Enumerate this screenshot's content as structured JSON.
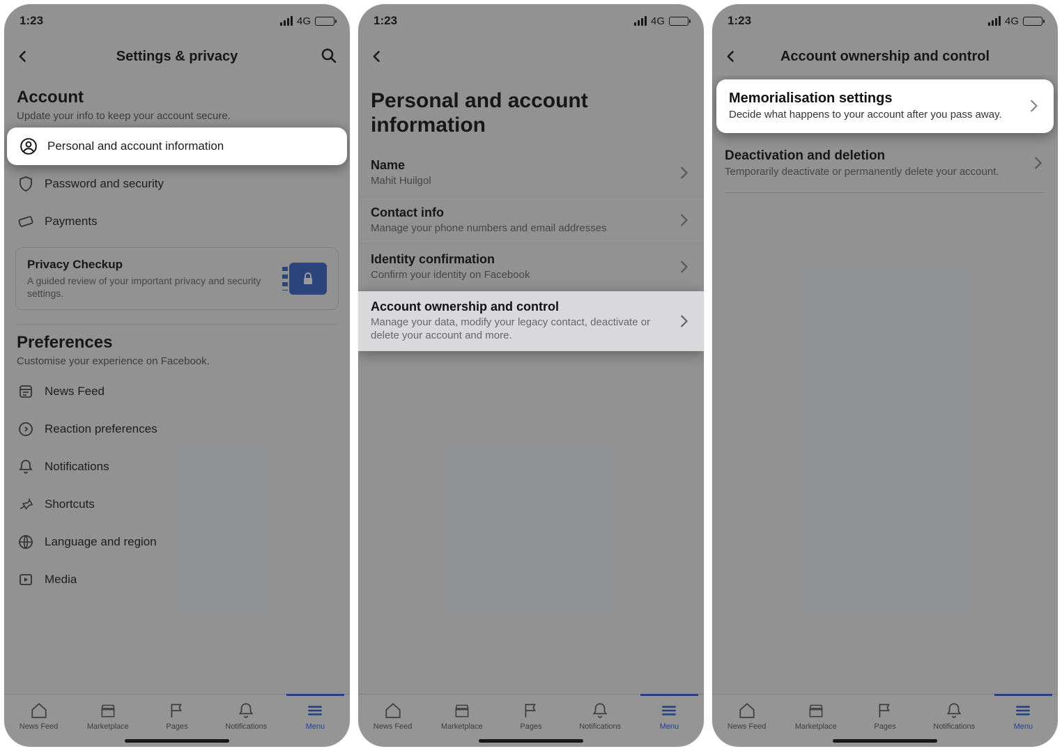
{
  "status": {
    "time": "1:23",
    "network": "4G"
  },
  "tabs": {
    "newsfeed": "News Feed",
    "marketplace": "Marketplace",
    "pages": "Pages",
    "notifications": "Notifications",
    "menu": "Menu"
  },
  "screen1": {
    "header_title": "Settings & privacy",
    "account_title": "Account",
    "account_sub": "Update your info to keep your account secure.",
    "row_personal": "Personal and account information",
    "row_password": "Password and security",
    "row_payments": "Payments",
    "privacy_title": "Privacy Checkup",
    "privacy_sub": "A guided review of your important privacy and security settings.",
    "prefs_title": "Preferences",
    "prefs_sub": "Customise your experience on Facebook.",
    "row_newsfeed": "News Feed",
    "row_reaction": "Reaction preferences",
    "row_notifications": "Notifications",
    "row_shortcuts": "Shortcuts",
    "row_language": "Language and region",
    "row_media": "Media"
  },
  "screen2": {
    "title": "Personal and account information",
    "name_label": "Name",
    "name_value": "Mahit Huilgol",
    "contact_label": "Contact info",
    "contact_sub": "Manage your phone numbers and email addresses",
    "identity_label": "Identity confirmation",
    "identity_sub": "Confirm your identity on Facebook",
    "ownership_label": "Account ownership and control",
    "ownership_sub": "Manage your data, modify your legacy contact, deactivate or delete your account and more."
  },
  "screen3": {
    "header_title": "Account ownership and control",
    "mem_title": "Memorialisation settings",
    "mem_sub": "Decide what happens to your account after you pass away.",
    "deact_title": "Deactivation and deletion",
    "deact_sub": "Temporarily deactivate or permanently delete your account."
  }
}
